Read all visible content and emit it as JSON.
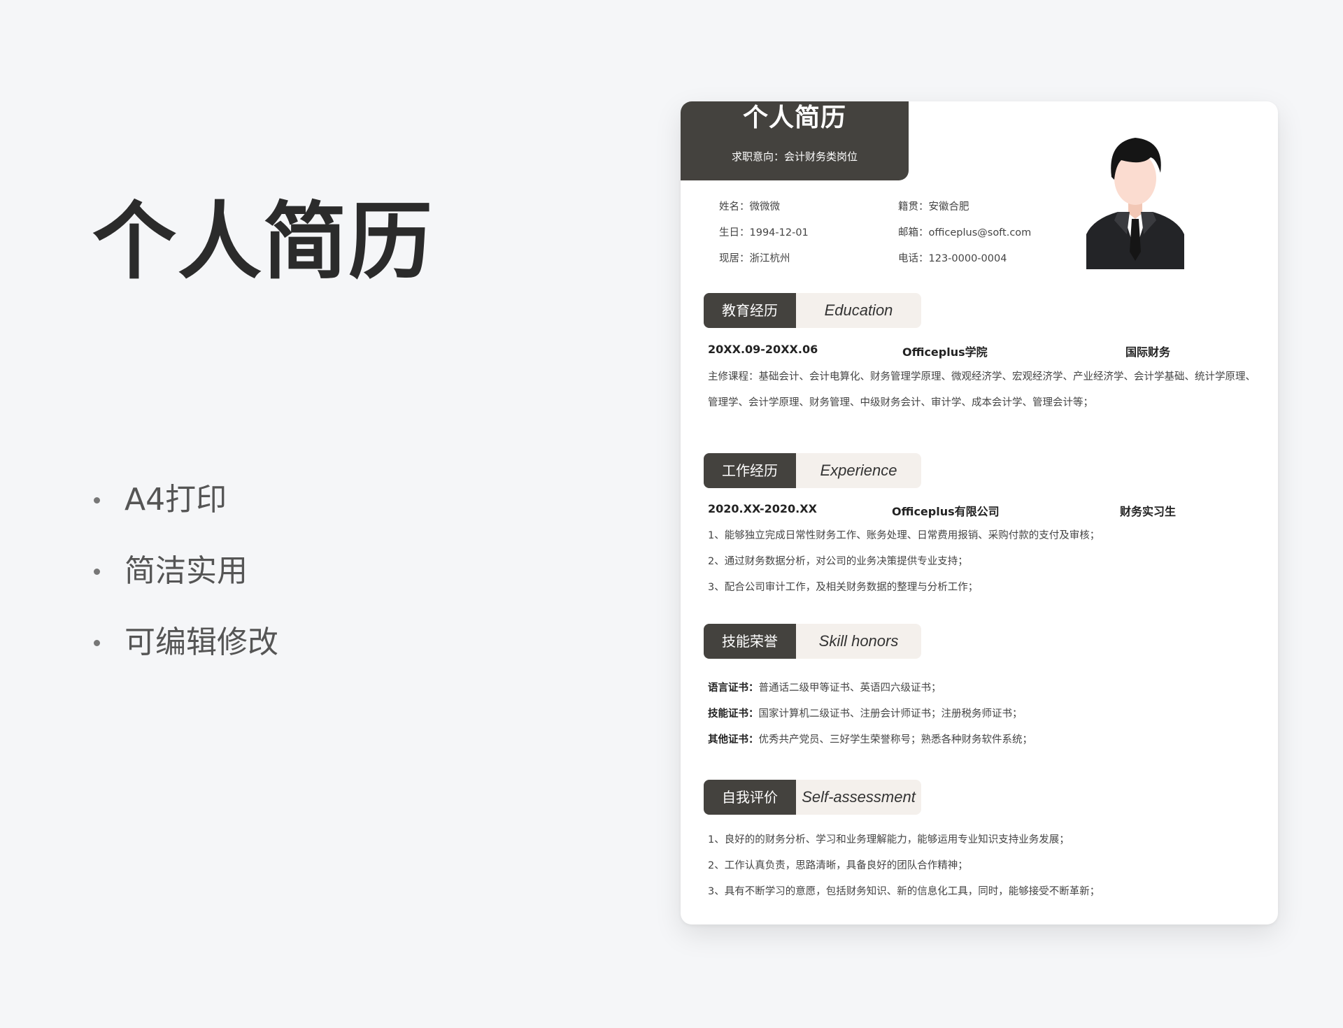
{
  "hero": {
    "title": "个人简历",
    "features": [
      "A4打印",
      "简洁实用",
      "可编辑修改"
    ]
  },
  "resume": {
    "title": "个人简历",
    "objective": "求职意向：会计财务类岗位",
    "info": {
      "name": "姓名：微微微",
      "birth": "生日：1994-12-01",
      "residence": "现居：浙江杭州",
      "origin": "籍贯：安徽合肥",
      "email": "邮箱：officeplus@soft.com",
      "phone": "电话：123-0000-0004"
    },
    "education": {
      "cn": "教育经历",
      "en": "Education",
      "date": "20XX.09-20XX.06",
      "school": "Officeplus学院",
      "major": "国际财务",
      "courses": "主修课程：基础会计、会计电算化、财务管理学原理、微观经济学、宏观经济学、产业经济学、会计学基础、统计学原理、管理学、会计学原理、财务管理、中级财务会计、审计学、成本会计学、管理会计等；"
    },
    "experience": {
      "cn": "工作经历",
      "en": "Experience",
      "date": "2020.XX-2020.XX",
      "company": "Officeplus有限公司",
      "role": "财务实习生",
      "items": [
        "1、能够独立完成日常性财务工作、账务处理、日常费用报销、采购付款的支付及审核；",
        "2、通过财务数据分析，对公司的业务决策提供专业支持；",
        "3、配合公司审计工作，及相关财务数据的整理与分析工作；"
      ]
    },
    "skills": {
      "cn": "技能荣誉",
      "en": "Skill honors",
      "items": [
        {
          "label": "语言证书：",
          "text": "普通话二级甲等证书、英语四六级证书；"
        },
        {
          "label": "技能证书：",
          "text": "国家计算机二级证书、注册会计师证书；注册税务师证书；"
        },
        {
          "label": "其他证书：",
          "text": "优秀共产党员、三好学生荣誉称号；熟悉各种财务软件系统；"
        }
      ]
    },
    "self": {
      "cn": "自我评价",
      "en": "Self-assessment",
      "items": [
        "1、良好的的财务分析、学习和业务理解能力，能够运用专业知识支持业务发展；",
        "2、工作认真负责，思路清晰，具备良好的团队合作精神；",
        "3、具有不断学习的意愿，包括财务知识、新的信息化工具，同时，能够接受不断革新；"
      ]
    },
    "photo_icon": "businessman-avatar-icon"
  }
}
